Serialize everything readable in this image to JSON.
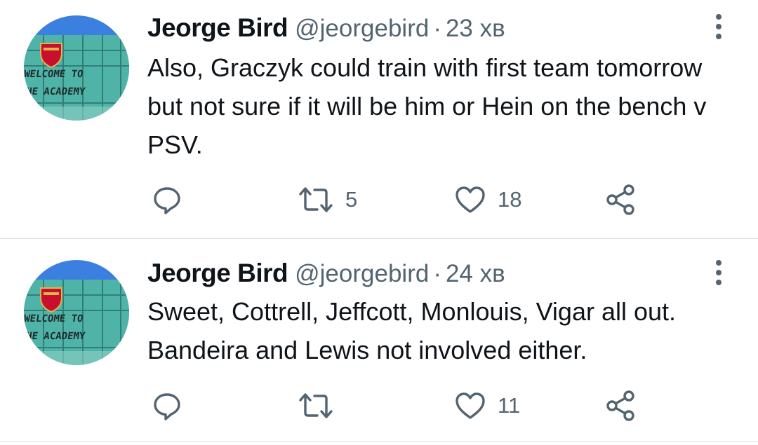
{
  "tweets": [
    {
      "author": {
        "display_name": "Jeorge Bird",
        "handle": "@jeorgebird",
        "avatar_text_line1": "WELCOME TO",
        "avatar_text_line2": "THE ACADEMY"
      },
      "separator": "·",
      "time": "23 хв",
      "text": "Also, Graczyk could train with first team tomorrow but not sure if it will be him or Hein on the bench v PSV.",
      "actions": {
        "reply_icon": "reply-icon",
        "retweet_icon": "retweet-icon",
        "retweet_count": "5",
        "like_icon": "heart-icon",
        "like_count": "18",
        "share_icon": "share-icon"
      }
    },
    {
      "author": {
        "display_name": "Jeorge Bird",
        "handle": "@jeorgebird",
        "avatar_text_line1": "WELCOME TO",
        "avatar_text_line2": "THE ACADEMY"
      },
      "separator": "·",
      "time": "24 хв",
      "text": "Sweet, Cottrell, Jeffcott, Monlouis, Vigar all out. Bandeira and Lewis not involved either.",
      "actions": {
        "reply_icon": "reply-icon",
        "retweet_icon": "retweet-icon",
        "retweet_count": "",
        "like_icon": "heart-icon",
        "like_count": "11",
        "share_icon": "share-icon"
      }
    }
  ],
  "colors": {
    "text_primary": "#0f1419",
    "text_secondary": "#536471",
    "icon": "#536471",
    "divider": "#d6dde3",
    "avatar_sky": "#3b7fe0",
    "avatar_building": "#4fb3a8"
  }
}
